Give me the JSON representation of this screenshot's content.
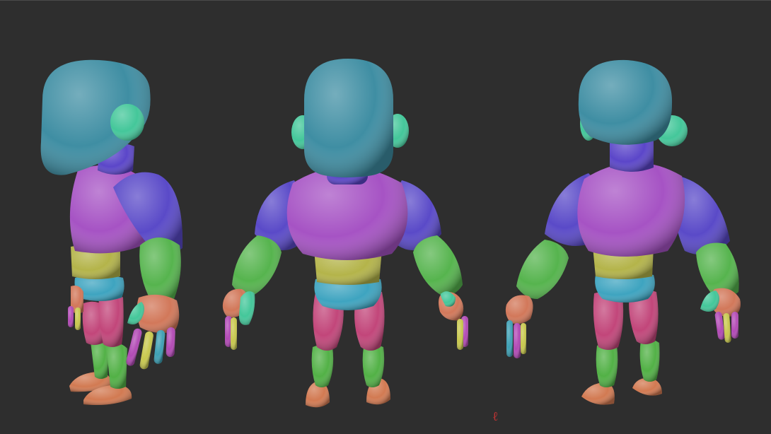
{
  "scene": {
    "background": "#2e2e2e",
    "views": [
      "side",
      "back",
      "three-quarter-back"
    ],
    "part_colors": {
      "head": "#3f8ea3",
      "ears": "#44c79a",
      "neck": "#5b46c9",
      "chest": "#a653c4",
      "upper_arms": "#5a4ac8",
      "forearms": "#56b44e",
      "hands": "#d2785a",
      "belt": "#b4b44a",
      "shorts": "#3ea4c0",
      "thighs": "#c2467a",
      "shins": "#52b146",
      "feet": "#d27a52",
      "fingers_magenta": "#b24ab5",
      "fingers_yellow": "#c8c84e",
      "fingers_teal": "#3ea0b4",
      "thumb": "#44c79a"
    }
  }
}
